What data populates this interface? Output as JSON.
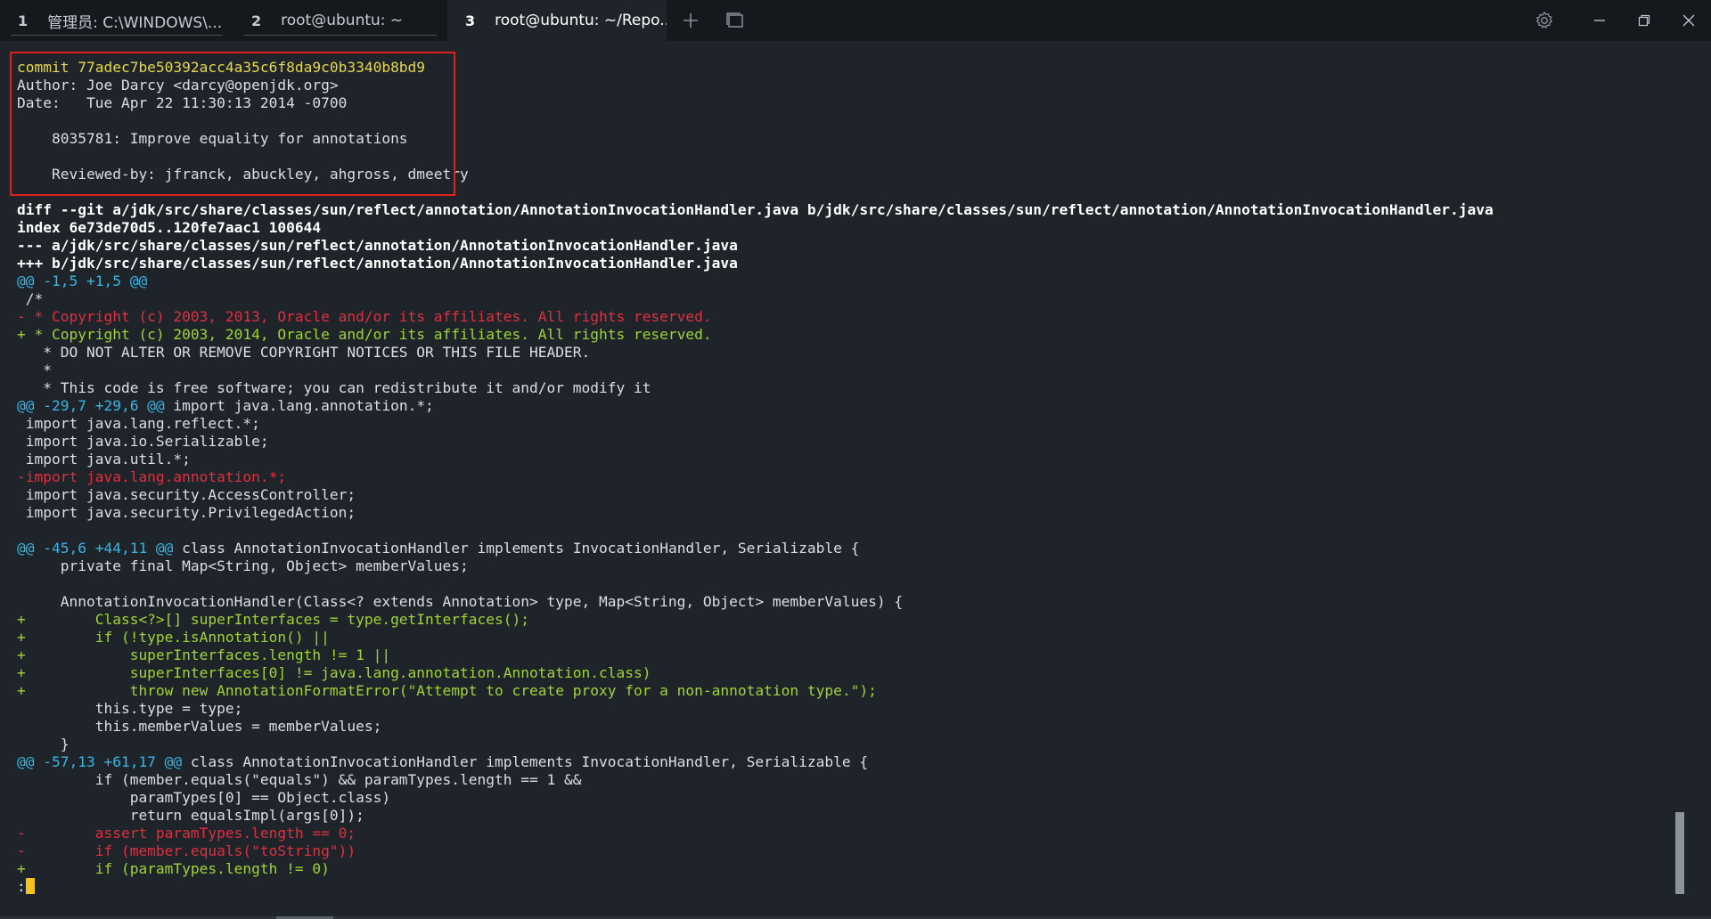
{
  "tabs": [
    {
      "index": "1",
      "title": "管理员: C:\\WINDOWS\\...",
      "active": false
    },
    {
      "index": "2",
      "title": "root@ubuntu: ~",
      "active": false
    },
    {
      "index": "3",
      "title": "root@ubuntu: ~/Repo...",
      "active": true
    }
  ],
  "icons": {
    "new_tab": "plus-icon",
    "tab_overview": "tab-list-icon",
    "settings": "gear-icon",
    "minimize": "minimize-icon",
    "restore": "restore-icon",
    "close": "close-icon"
  },
  "colors": {
    "background": "#1e2429",
    "commit": "#e6d84a",
    "hunk": "#38b6e6",
    "removed": "#e0303f",
    "added": "#9fd534",
    "cursor": "#f5c21b",
    "highlight_box": "#e02020"
  },
  "terminal": {
    "lines": [
      {
        "style": "yellow",
        "text": "commit 77adec7be50392acc4a35c6f8da9c0b3340b8bd9"
      },
      {
        "style": "white",
        "text": "Author: Joe Darcy <darcy@openjdk.org>"
      },
      {
        "style": "white",
        "text": "Date:   Tue Apr 22 11:30:13 2014 -0700"
      },
      {
        "style": "white",
        "text": ""
      },
      {
        "style": "white",
        "text": "    8035781: Improve equality for annotations"
      },
      {
        "style": "white",
        "text": ""
      },
      {
        "style": "white",
        "text": "    Reviewed-by: jfranck, abuckley, ahgross, dmeetry"
      },
      {
        "style": "white",
        "text": ""
      },
      {
        "style": "bold",
        "text": "diff --git a/jdk/src/share/classes/sun/reflect/annotation/AnnotationInvocationHandler.java b/jdk/src/share/classes/sun/reflect/annotation/AnnotationInvocationHandler.java"
      },
      {
        "style": "bold",
        "text": "index 6e73de70d5..120fe7aac1 100644"
      },
      {
        "style": "bold",
        "text": "--- a/jdk/src/share/classes/sun/reflect/annotation/AnnotationInvocationHandler.java"
      },
      {
        "style": "bold",
        "text": "+++ b/jdk/src/share/classes/sun/reflect/annotation/AnnotationInvocationHandler.java"
      },
      {
        "style": "hunk",
        "hunk": "@@ -1,5 +1,5 @@",
        "text": ""
      },
      {
        "style": "white",
        "text": " /*"
      },
      {
        "style": "red",
        "text": "- * Copyright (c) 2003, 2013, Oracle and/or its affiliates. All rights reserved."
      },
      {
        "style": "green",
        "text": "+ * Copyright (c) 2003, 2014, Oracle and/or its affiliates. All rights reserved."
      },
      {
        "style": "white",
        "text": "   * DO NOT ALTER OR REMOVE COPYRIGHT NOTICES OR THIS FILE HEADER."
      },
      {
        "style": "white",
        "text": "   *"
      },
      {
        "style": "white",
        "text": "   * This code is free software; you can redistribute it and/or modify it"
      },
      {
        "style": "hunk",
        "hunk": "@@ -29,7 +29,6 @@",
        "text": " import java.lang.annotation.*;"
      },
      {
        "style": "white",
        "text": " import java.lang.reflect.*;"
      },
      {
        "style": "white",
        "text": " import java.io.Serializable;"
      },
      {
        "style": "white",
        "text": " import java.util.*;"
      },
      {
        "style": "red",
        "text": "-import java.lang.annotation.*;"
      },
      {
        "style": "white",
        "text": " import java.security.AccessController;"
      },
      {
        "style": "white",
        "text": " import java.security.PrivilegedAction;"
      },
      {
        "style": "white",
        "text": ""
      },
      {
        "style": "hunk",
        "hunk": "@@ -45,6 +44,11 @@",
        "text": " class AnnotationInvocationHandler implements InvocationHandler, Serializable {"
      },
      {
        "style": "white",
        "text": "     private final Map<String, Object> memberValues;"
      },
      {
        "style": "white",
        "text": ""
      },
      {
        "style": "white",
        "text": "     AnnotationInvocationHandler(Class<? extends Annotation> type, Map<String, Object> memberValues) {"
      },
      {
        "style": "green",
        "text": "+        Class<?>[] superInterfaces = type.getInterfaces();"
      },
      {
        "style": "green",
        "text": "+        if (!type.isAnnotation() ||"
      },
      {
        "style": "green",
        "text": "+            superInterfaces.length != 1 ||"
      },
      {
        "style": "green",
        "text": "+            superInterfaces[0] != java.lang.annotation.Annotation.class)"
      },
      {
        "style": "green",
        "text": "+            throw new AnnotationFormatError(\"Attempt to create proxy for a non-annotation type.\");"
      },
      {
        "style": "white",
        "text": "         this.type = type;"
      },
      {
        "style": "white",
        "text": "         this.memberValues = memberValues;"
      },
      {
        "style": "white",
        "text": "     }"
      },
      {
        "style": "hunk",
        "hunk": "@@ -57,13 +61,17 @@",
        "text": " class AnnotationInvocationHandler implements InvocationHandler, Serializable {"
      },
      {
        "style": "white",
        "text": "         if (member.equals(\"equals\") && paramTypes.length == 1 &&"
      },
      {
        "style": "white",
        "text": "             paramTypes[0] == Object.class)"
      },
      {
        "style": "white",
        "text": "             return equalsImpl(args[0]);"
      },
      {
        "style": "red",
        "text": "-        assert paramTypes.length == 0;"
      },
      {
        "style": "red",
        "text": "-        if (member.equals(\"toString\"))"
      },
      {
        "style": "green",
        "text": "+        if (paramTypes.length != 0)"
      }
    ],
    "prompt": ":"
  }
}
